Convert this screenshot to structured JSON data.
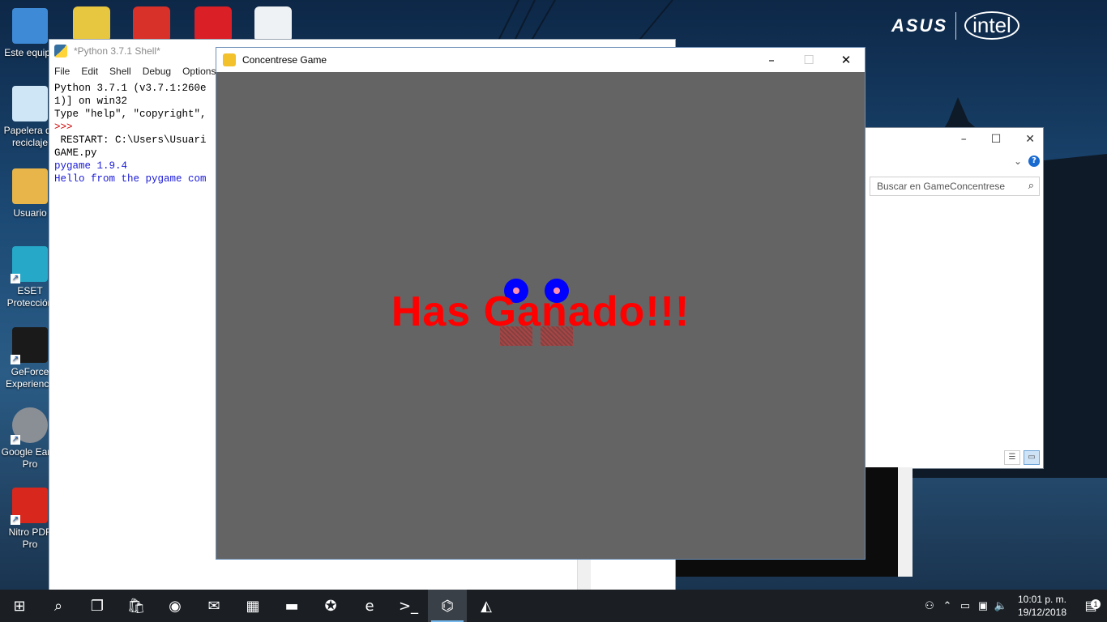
{
  "desktop": {
    "brand": {
      "asus": "ASUS",
      "intel": "intel"
    },
    "icons": [
      {
        "label": "Este equipo",
        "icon": "computer-icon",
        "color": "#3e8ad6"
      },
      {
        "label": "Papelera de reciclaje",
        "icon": "recycle-bin-icon",
        "color": "#cfe6f7"
      },
      {
        "label": "Usuario",
        "icon": "user-folder-icon",
        "color": "#e8b54a"
      },
      {
        "label": "ESET Protección",
        "icon": "eset-icon",
        "color": "#26a9c8"
      },
      {
        "label": "GeForce Experience",
        "icon": "geforce-icon",
        "color": "#1a1a1a"
      },
      {
        "label": "Google Earth Pro",
        "icon": "google-earth-icon",
        "color": "#8a8f96"
      },
      {
        "label": "Nitro PDF Pro",
        "icon": "nitro-pdf-icon",
        "color": "#d8281e"
      }
    ],
    "top_apps": [
      {
        "icon": "dvd-app-icon",
        "color": "#e7c640"
      },
      {
        "icon": "ccleaner-icon",
        "color": "#d8312a"
      },
      {
        "icon": "adobe-cc-icon",
        "color": "#da1f26"
      },
      {
        "icon": "warframe-icon",
        "color": "#eef2f4"
      }
    ]
  },
  "shell": {
    "title": "*Python 3.7.1 Shell*",
    "menu": [
      "File",
      "Edit",
      "Shell",
      "Debug",
      "Options"
    ],
    "lines": [
      {
        "text": "Python 3.7.1 (v3.7.1:260e",
        "style": "black"
      },
      {
        "text": "1)] on win32",
        "style": "black"
      },
      {
        "text": "Type \"help\", \"copyright\",",
        "style": "black"
      },
      {
        "text": ">>>",
        "style": "red"
      },
      {
        "text": " RESTART: C:\\Users\\Usuari",
        "style": "black"
      },
      {
        "text": "GAME.py",
        "style": "black"
      },
      {
        "text": "pygame 1.9.4",
        "style": "blue"
      },
      {
        "text": "Hello from the pygame com",
        "style": "blue"
      }
    ]
  },
  "explorer": {
    "search_placeholder": "Buscar en GameConcentrese"
  },
  "game": {
    "title": "Concentrese Game",
    "message": "Has Ganado!!!",
    "colors": {
      "background": "#646464",
      "text": "#ff0000",
      "circle": "#0000ff"
    }
  },
  "taskbar": {
    "items": [
      {
        "icon": "windows-start-icon",
        "glyph": "⊞"
      },
      {
        "icon": "search-icon",
        "glyph": "⌕"
      },
      {
        "icon": "task-view-icon",
        "glyph": "❐"
      },
      {
        "icon": "store-icon",
        "glyph": "🛍"
      },
      {
        "icon": "chrome-icon",
        "glyph": "◉"
      },
      {
        "icon": "mail-icon",
        "glyph": "✉"
      },
      {
        "icon": "calculator-icon",
        "glyph": "▦"
      },
      {
        "icon": "file-explorer-icon",
        "glyph": "▬"
      },
      {
        "icon": "game-app-icon",
        "glyph": "✪"
      },
      {
        "icon": "edge-icon",
        "glyph": "e"
      },
      {
        "icon": "terminal-icon",
        "glyph": ">_"
      },
      {
        "icon": "python-icon",
        "glyph": "⌬"
      },
      {
        "icon": "pygame-icon",
        "glyph": "◭"
      }
    ],
    "time": "10:01 p. m.",
    "date": "19/12/2018",
    "notifications": "1"
  }
}
